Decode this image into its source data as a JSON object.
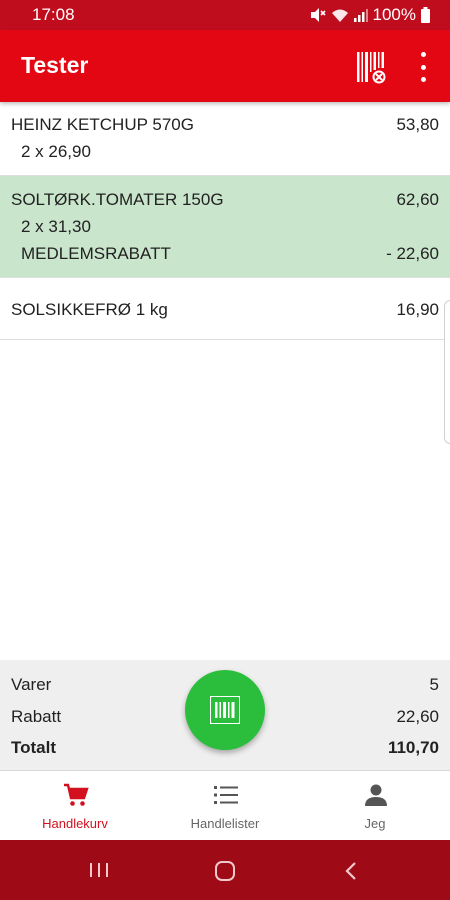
{
  "status_bar": {
    "time": "17:08",
    "battery": "100%"
  },
  "app_bar": {
    "title": "Tester",
    "icons": [
      "barcode-scan-icon",
      "more-vert-icon"
    ]
  },
  "cart": {
    "items": [
      {
        "name": "HEINZ KETCHUP 570G",
        "price": "53,80",
        "qty_line": "2 x  26,90"
      },
      {
        "name": "SOLTØRK.TOMATER 150G",
        "price": "62,60",
        "qty_line": "2 x  31,30",
        "discount_label": "MEDLEMSRABATT",
        "discount_value": "- 22,60",
        "highlight_color": "#c9e5cc"
      },
      {
        "name": "SOLSIKKEFRØ 1 kg",
        "price": "16,90"
      }
    ]
  },
  "summary": {
    "items_label": "Varer",
    "items_value": "5",
    "discount_label": "Rabatt",
    "discount_value": "22,60",
    "total_label": "Totalt",
    "total_value": "110,70"
  },
  "fab": {
    "icon": "barcode-icon",
    "color": "#2bbd3c"
  },
  "bottom_nav": {
    "items": [
      {
        "label": "Handlekurv",
        "icon": "cart-icon",
        "active": true
      },
      {
        "label": "Handlelister",
        "icon": "list-icon",
        "active": false
      },
      {
        "label": "Jeg",
        "icon": "person-icon",
        "active": false
      }
    ]
  },
  "colors": {
    "brand_red": "#e30613",
    "status_red": "#c00d1e",
    "nav_bar": "#9e0b17",
    "active_nav": "#d21020"
  }
}
